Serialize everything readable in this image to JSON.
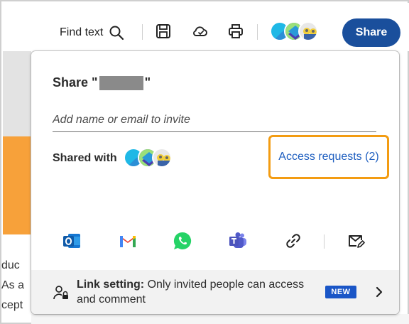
{
  "toolbar": {
    "find_text_label": "Find text",
    "icons": [
      "search-icon",
      "save-icon",
      "cloud-sync-icon",
      "print-icon"
    ],
    "share_button_label": "Share"
  },
  "background": {
    "text_lines": [
      "duc",
      "As a",
      "cept"
    ]
  },
  "share_dialog": {
    "title_prefix": "Share \"",
    "title_suffix": "\"",
    "invite_placeholder": "Add name or email to invite",
    "shared_with_label": "Shared with",
    "access_requests_label": "Access requests (2)",
    "share_apps": [
      "outlook-icon",
      "gmail-icon",
      "whatsapp-icon",
      "teams-icon",
      "link-icon",
      "email-icon"
    ],
    "link_setting": {
      "label": "Link setting:",
      "description": "Only invited people can access and comment",
      "badge": "NEW"
    }
  },
  "colors": {
    "share_button": "#1a4f9c",
    "access_highlight": "#f39c12",
    "link": "#1f5fc0",
    "new_badge": "#1a56c7",
    "side_accent": "#f7a13a"
  }
}
